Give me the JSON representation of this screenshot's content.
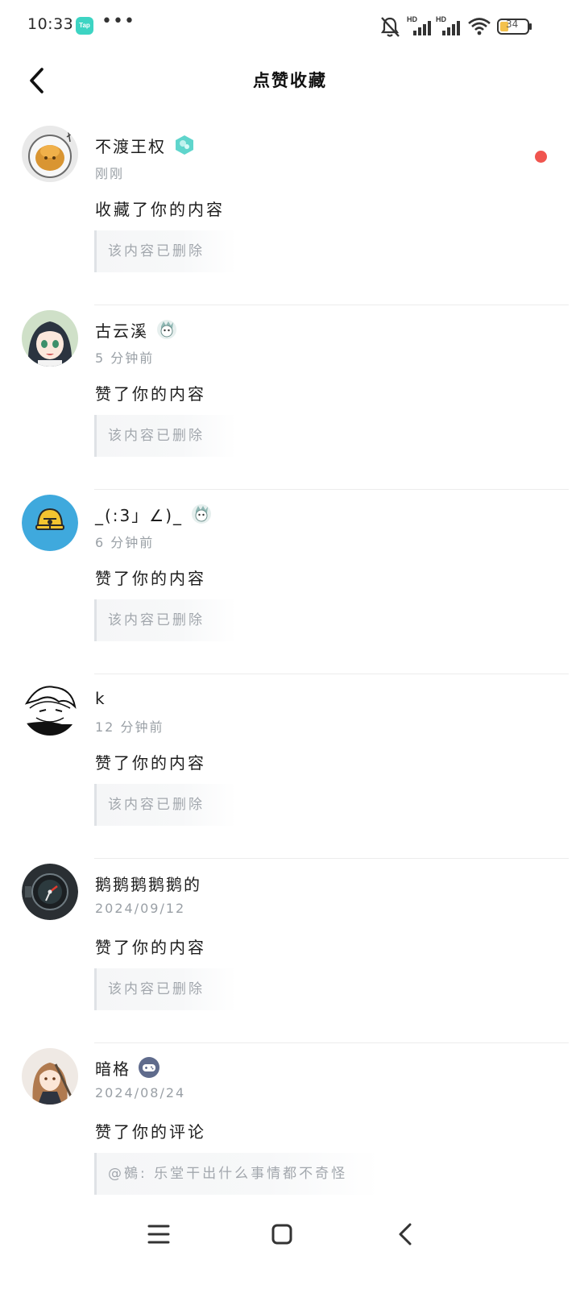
{
  "status_bar": {
    "time": "10:33",
    "app_icon_text": "Tap",
    "more": "•••",
    "battery": "34"
  },
  "header": {
    "title": "点赞收藏"
  },
  "notifications": [
    {
      "username": "不渡王权",
      "badge": "teal-gem-badge",
      "time": "刚刚",
      "action": "收藏了你的内容",
      "quote": "该内容已删除",
      "unread": true
    },
    {
      "username": "古云溪",
      "badge": "mascot-badge",
      "time": "5 分钟前",
      "action": "赞了你的内容",
      "quote": "该内容已删除",
      "unread": false
    },
    {
      "username": "_(:3」∠)_",
      "badge": "mascot-badge",
      "time": "6 分钟前",
      "action": "赞了你的内容",
      "quote": "该内容已删除",
      "unread": false
    },
    {
      "username": "k",
      "badge": "",
      "time": "12 分钟前",
      "action": "赞了你的内容",
      "quote": "该内容已删除",
      "unread": false
    },
    {
      "username": "鹅鹅鹅鹅鹅的",
      "badge": "",
      "time": "2024/09/12",
      "action": "赞了你的内容",
      "quote": "该内容已删除",
      "unread": false
    },
    {
      "username": "暗格",
      "badge": "gamepad-badge",
      "time": "2024/08/24",
      "action": "赞了你的评论",
      "quote": "@鵺: 乐堂干出什么事情都不奇怪",
      "unread": false
    }
  ],
  "colors": {
    "accent_teal": "#3dd4c3",
    "unread_dot": "#f0554f",
    "secondary_text": "#9aa0a6",
    "avatar_blue": "#3fa9dd"
  }
}
